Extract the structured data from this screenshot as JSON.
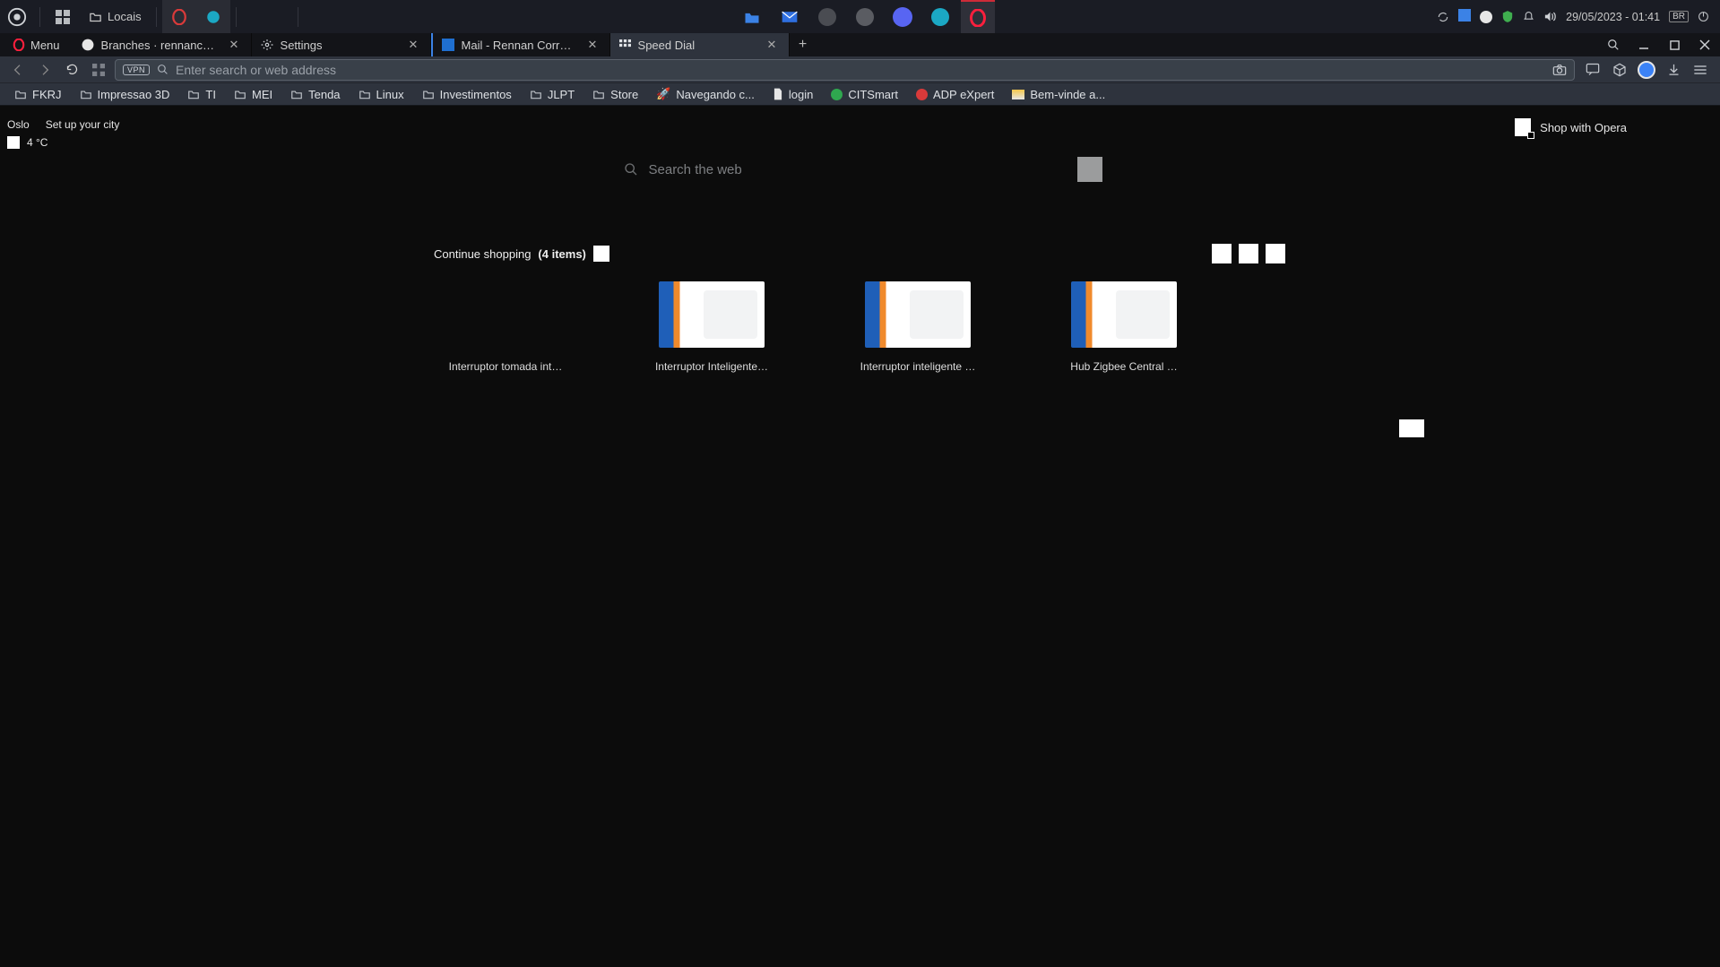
{
  "taskbar": {
    "locais_label": "Locais",
    "datetime": "29/05/2023 - 01:41",
    "keyboard": "BR"
  },
  "browser": {
    "menu_label": "Menu",
    "tabs": [
      {
        "label": "Branches · rennanc…",
        "icon": "github"
      },
      {
        "label": "Settings",
        "icon": "gear"
      },
      {
        "label": "Mail - Rennan Corr…",
        "icon": "outlook"
      },
      {
        "label": "Speed Dial",
        "icon": "speeddial",
        "active": true
      }
    ],
    "address_placeholder": "Enter search or web address",
    "vpn_label": "VPN"
  },
  "bookmarks": [
    {
      "label": "FKRJ",
      "type": "folder"
    },
    {
      "label": "Impressao 3D",
      "type": "folder"
    },
    {
      "label": "TI",
      "type": "folder"
    },
    {
      "label": "MEI",
      "type": "folder"
    },
    {
      "label": "Tenda",
      "type": "folder"
    },
    {
      "label": "Linux",
      "type": "folder"
    },
    {
      "label": "Investimentos",
      "type": "folder"
    },
    {
      "label": "JLPT",
      "type": "folder"
    },
    {
      "label": "Store",
      "type": "folder"
    },
    {
      "label": "Navegando c...",
      "type": "site",
      "icon": "rocket"
    },
    {
      "label": "login",
      "type": "site",
      "icon": "doc"
    },
    {
      "label": "CITSmart",
      "type": "site",
      "icon": "green"
    },
    {
      "label": "ADP eXpert",
      "type": "site",
      "icon": "red"
    },
    {
      "label": "Bem-vinde a...",
      "type": "site",
      "icon": "card"
    }
  ],
  "weather": {
    "city": "Oslo",
    "setup_label": "Set up your city",
    "temp": "4 °C"
  },
  "shop_opera_label": "Shop with Opera",
  "search_placeholder": "Search the web",
  "shopping": {
    "title": "Continue shopping",
    "count_label": "(4 items)",
    "items": [
      {
        "label": "Interruptor tomada int…",
        "thumb": false
      },
      {
        "label": "Interruptor Inteligente…",
        "thumb": true
      },
      {
        "label": "Interruptor inteligente …",
        "thumb": true
      },
      {
        "label": "Hub Zigbee Central …",
        "thumb": true
      }
    ]
  }
}
